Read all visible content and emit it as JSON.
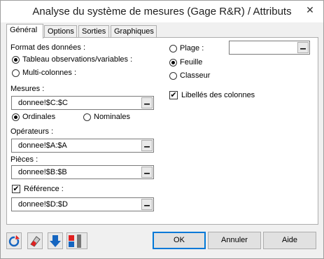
{
  "window": {
    "title": "Analyse du système de mesures (Gage R&R) / Attributs",
    "close_glyph": "✕"
  },
  "tabs": [
    {
      "label": "Général",
      "active": true
    },
    {
      "label": "Options",
      "active": false
    },
    {
      "label": "Sorties",
      "active": false
    },
    {
      "label": "Graphiques",
      "active": false
    }
  ],
  "general": {
    "format_label": "Format des données :",
    "format_options": [
      {
        "label": "Tableau observations/variables :",
        "selected": true
      },
      {
        "label": "Multi-colonnes :",
        "selected": false
      }
    ],
    "mesures_label": "Mesures :",
    "mesures_value": "donnee!$C:$C",
    "scale_options": [
      {
        "label": "Ordinales",
        "selected": true
      },
      {
        "label": "Nominales",
        "selected": false
      }
    ],
    "operateurs_label": "Opérateurs :",
    "operateurs_value": "donnee!$A:$A",
    "pieces_label": "Pièces :",
    "pieces_value": "donnee!$B:$B",
    "reference_label": "Référence :",
    "reference_checked": true,
    "reference_value": "donnee!$D:$D",
    "picker_glyph": "▁",
    "output_options": [
      {
        "label": "Plage :",
        "selected": false
      },
      {
        "label": "Feuille",
        "selected": true
      },
      {
        "label": "Classeur",
        "selected": false
      }
    ],
    "plage_value": "",
    "column_labels": {
      "label": "Libellés des colonnes",
      "checked": true
    }
  },
  "buttons": {
    "ok": "OK",
    "cancel": "Annuler",
    "help": "Aide"
  },
  "toolbar": [
    {
      "icon": "reset-icon"
    },
    {
      "icon": "eraser-icon"
    },
    {
      "icon": "down-arrow-icon"
    },
    {
      "icon": "color-blocks-icon"
    }
  ],
  "colors": {
    "accent": "#0078d7",
    "arrow_blue": "#1565c0",
    "red": "#e02020"
  }
}
